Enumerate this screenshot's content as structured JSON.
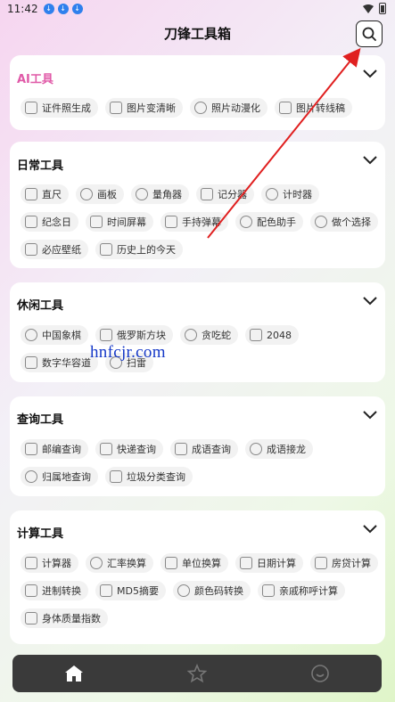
{
  "status_bar": {
    "time": "11:42"
  },
  "header": {
    "title": "刀锋工具箱"
  },
  "watermark": "hnfcjr.com",
  "sections": [
    {
      "title": "AI工具",
      "title_color": "#e05aa8",
      "items": [
        {
          "label": "证件照生成",
          "icon": "id-card-icon"
        },
        {
          "label": "图片变清晰",
          "icon": "hd-icon"
        },
        {
          "label": "照片动漫化",
          "icon": "sparkle-icon"
        },
        {
          "label": "图片转线稿",
          "icon": "pencil-icon"
        }
      ]
    },
    {
      "title": "日常工具",
      "items": [
        {
          "label": "直尺",
          "icon": "ruler-icon"
        },
        {
          "label": "画板",
          "icon": "palette-icon"
        },
        {
          "label": "量角器",
          "icon": "protractor-icon"
        },
        {
          "label": "记分器",
          "icon": "scoreboard-icon"
        },
        {
          "label": "计时器",
          "icon": "timer-icon"
        },
        {
          "label": "纪念日",
          "icon": "calendar-icon"
        },
        {
          "label": "时间屏幕",
          "icon": "clock-screen-icon"
        },
        {
          "label": "手持弹幕",
          "icon": "marquee-icon"
        },
        {
          "label": "配色助手",
          "icon": "color-palette-icon"
        },
        {
          "label": "做个选择",
          "icon": "choice-icon"
        },
        {
          "label": "必应壁纸",
          "icon": "wallpaper-icon"
        },
        {
          "label": "历史上的今天",
          "icon": "history-icon"
        }
      ]
    },
    {
      "title": "休闲工具",
      "items": [
        {
          "label": "中国象棋",
          "icon": "chess-icon"
        },
        {
          "label": "俄罗斯方块",
          "icon": "tetris-icon"
        },
        {
          "label": "贪吃蛇",
          "icon": "snake-icon"
        },
        {
          "label": "2048",
          "icon": "grid-icon"
        },
        {
          "label": "数字华容道",
          "icon": "puzzle-icon"
        },
        {
          "label": "扫雷",
          "icon": "mine-icon"
        }
      ]
    },
    {
      "title": "查询工具",
      "items": [
        {
          "label": "邮编查询",
          "icon": "postcode-icon"
        },
        {
          "label": "快递查询",
          "icon": "truck-icon"
        },
        {
          "label": "成语查询",
          "icon": "book-icon"
        },
        {
          "label": "成语接龙",
          "icon": "chain-icon"
        },
        {
          "label": "归属地查询",
          "icon": "location-icon"
        },
        {
          "label": "垃圾分类查询",
          "icon": "trash-icon"
        }
      ]
    },
    {
      "title": "计算工具",
      "items": [
        {
          "label": "计算器",
          "icon": "calculator-icon"
        },
        {
          "label": "汇率换算",
          "icon": "currency-icon"
        },
        {
          "label": "单位换算",
          "icon": "unit-icon"
        },
        {
          "label": "日期计算",
          "icon": "date-calc-icon"
        },
        {
          "label": "房贷计算",
          "icon": "house-icon"
        },
        {
          "label": "进制转换",
          "icon": "base-convert-icon"
        },
        {
          "label": "MD5摘要",
          "icon": "md5-icon"
        },
        {
          "label": "颜色码转换",
          "icon": "color-code-icon"
        },
        {
          "label": "亲戚称呼计算",
          "icon": "relatives-icon"
        },
        {
          "label": "身体质量指数",
          "icon": "bmi-icon"
        }
      ]
    }
  ],
  "bottom_nav": [
    {
      "name": "home-icon",
      "active": true
    },
    {
      "name": "star-icon",
      "active": false
    },
    {
      "name": "smile-icon",
      "active": false
    }
  ],
  "colors": {
    "nav_bg": "#3a3a3a",
    "arrow": "#e02020",
    "watermark": "#1639c8"
  }
}
